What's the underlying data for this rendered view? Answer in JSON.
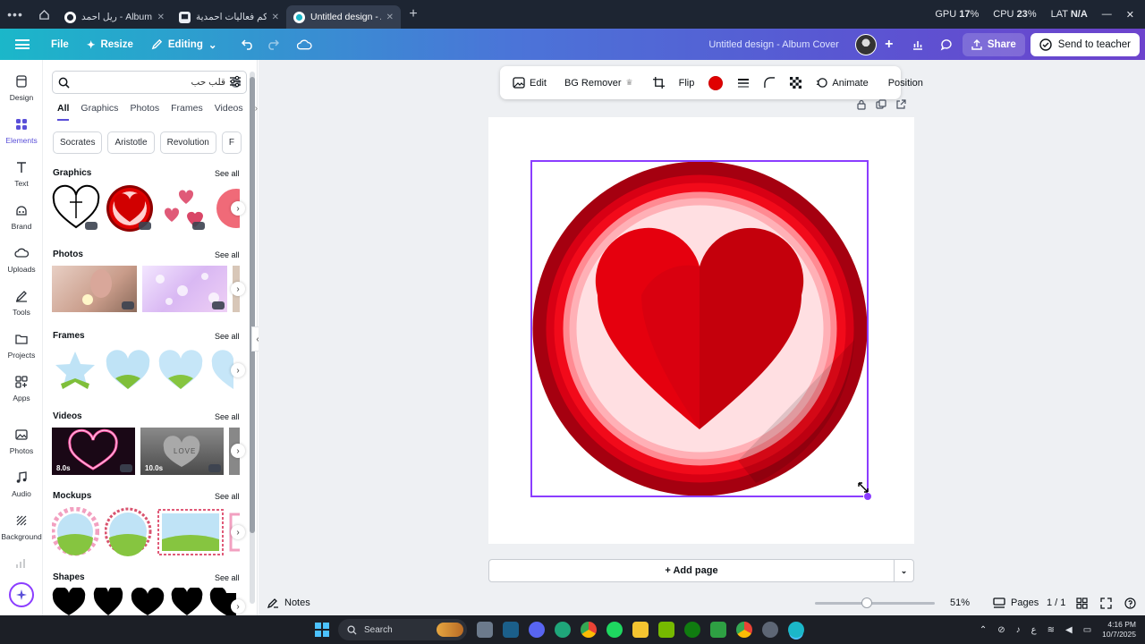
{
  "browser": {
    "tabs": [
      {
        "label": "ريل احمد - Album Co",
        "active": false
      },
      {
        "label": "حياكم فعاليات احمدية -",
        "active": false
      },
      {
        "label": "Untitled design - Al...",
        "active": true
      }
    ],
    "stats": {
      "gpu_label": "GPU",
      "gpu_value": "17",
      "gpu_unit": "%",
      "cpu_label": "CPU",
      "cpu_value": "23",
      "cpu_unit": "%",
      "lat_label": "LAT",
      "lat_value": "N/A"
    }
  },
  "header": {
    "file_label": "File",
    "resize_label": "Resize",
    "editing_label": "Editing",
    "doc_title": "Untitled design - Album Cover",
    "share_label": "Share",
    "send_label": "Send to teacher"
  },
  "rail": {
    "items": [
      {
        "label": "Design"
      },
      {
        "label": "Elements"
      },
      {
        "label": "Text"
      },
      {
        "label": "Brand"
      },
      {
        "label": "Uploads"
      },
      {
        "label": "Tools"
      },
      {
        "label": "Projects"
      },
      {
        "label": "Apps"
      },
      {
        "label": "Photos"
      },
      {
        "label": "Audio"
      },
      {
        "label": "Background"
      }
    ]
  },
  "panel": {
    "search_value": "قلب حب",
    "tabs": [
      "All",
      "Graphics",
      "Photos",
      "Frames",
      "Videos"
    ],
    "chips": [
      "Socrates",
      "Aristotle",
      "Revolution",
      "F"
    ],
    "sections": {
      "graphics": "Graphics",
      "photos": "Photos",
      "frames": "Frames",
      "videos": "Videos",
      "mockups": "Mockups",
      "shapes": "Shapes"
    },
    "see_all": "See all",
    "video_durations": [
      "8.0s",
      "10.0s"
    ],
    "love_stone_text": "LOVE"
  },
  "toolbar": {
    "edit_label": "Edit",
    "bg_remover_label": "BG Remover",
    "flip_label": "Flip",
    "color": "#e00000",
    "animate_label": "Animate",
    "position_label": "Position"
  },
  "canvas": {
    "add_page_label": "+ Add page"
  },
  "footer": {
    "notes_label": "Notes",
    "zoom_value": "51%",
    "zoom_level": 0.51,
    "pages_label": "Pages",
    "page_count": "1 / 1"
  },
  "taskbar": {
    "search_label": "Search",
    "time": "4:16 PM",
    "date": "10/7/2025",
    "lang": "ع"
  },
  "colors": {
    "accent": "#8b3dff",
    "canva_purple": "#5a4fd8",
    "heart_red": "#e00000"
  }
}
